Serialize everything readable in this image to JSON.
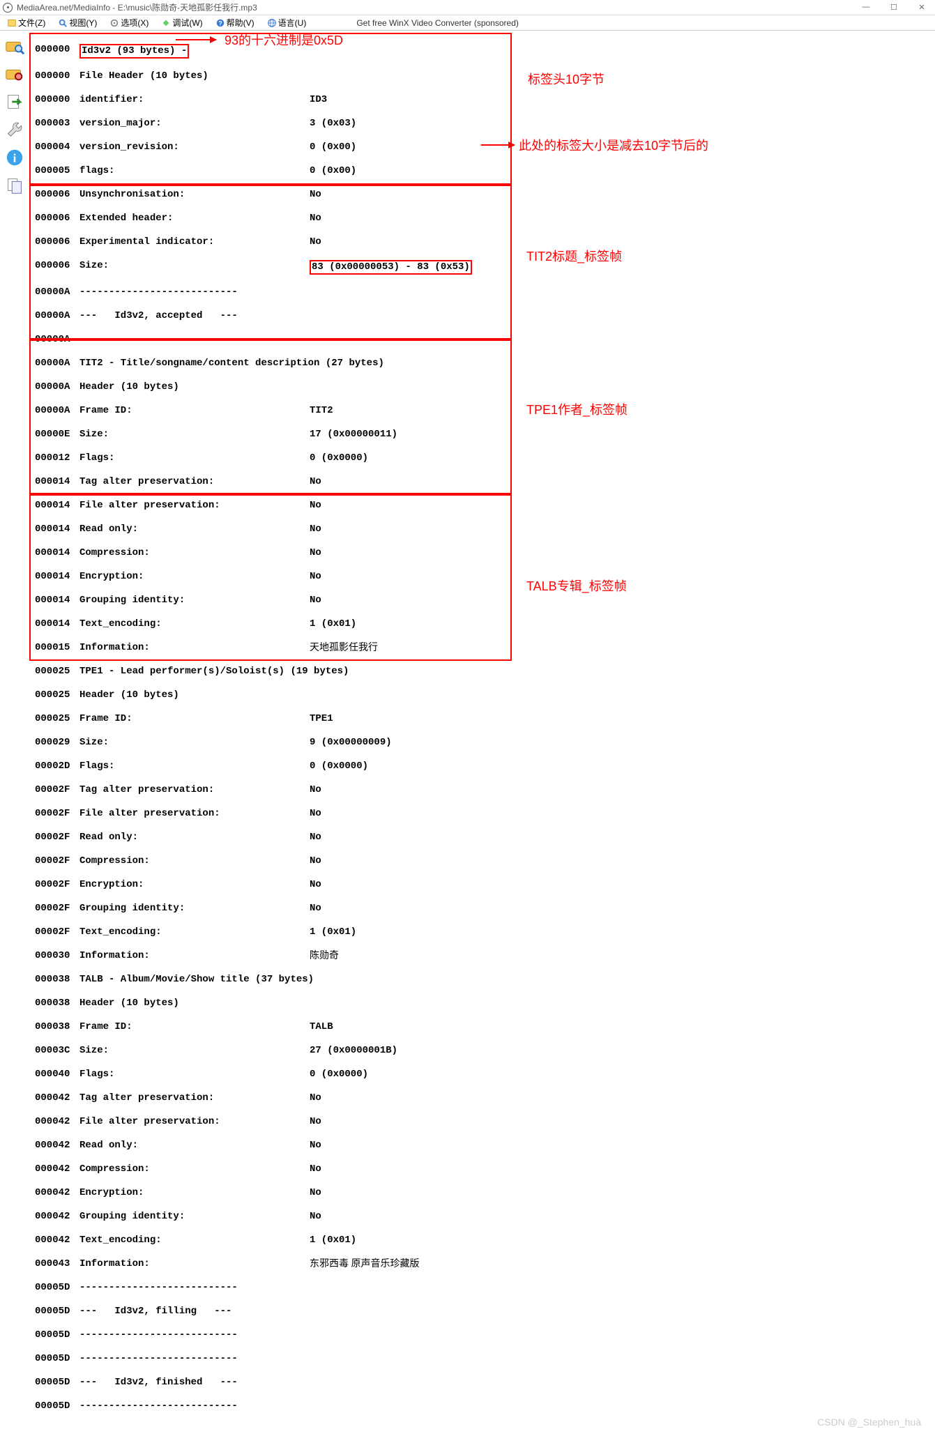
{
  "title": "MediaArea.net/MediaInfo - E:\\music\\陈勋奇-天地孤影任我行.mp3",
  "menus": {
    "file": "文件(Z)",
    "view": "视图(Y)",
    "options": "选项(X)",
    "debug": "调试(W)",
    "help": "帮助(V)",
    "language": "语言(U)",
    "sponsored": "Get free WinX Video Converter (sponsored)"
  },
  "sidebar_icons": [
    "folder-open",
    "folder-gear",
    "export",
    "wrench",
    "info",
    "clipboard"
  ],
  "annotations": {
    "a0": "93的十六进制是0x5D",
    "a1": "标签头10字节",
    "a2": "此处的标签大小是减去10字节后的",
    "a3": "TIT2标题_标签帧",
    "a4": "TPE1作者_标签帧",
    "a5": "TALB专辑_标签帧"
  },
  "hdr": {
    "id3v2_line": "Id3v2 (93 bytes) -",
    "file_header": "File Header (10 bytes)",
    "identifier_l": "identifier:",
    "identifier_v": "ID3",
    "vmaj_l": "version_major:",
    "vmaj_v": "3 (0x03)",
    "vrev_l": "version_revision:",
    "vrev_v": "0 (0x00)",
    "flags_l": "flags:",
    "flags_v": "0 (0x00)",
    "unsync_l": "Unsynchronisation:",
    "unsync_v": "No",
    "exthdr_l": "Extended header:",
    "exthdr_v": "No",
    "exp_l": "Experimental indicator:",
    "exp_v": "No",
    "size_l": "Size:",
    "size_v": "83 (0x00000053) - 83 (0x53)",
    "sep": "---------------------------",
    "accepted": "---   Id3v2, accepted   ---"
  },
  "tit2": {
    "head": "TIT2 - Title/songname/content description (27 bytes)",
    "hdr10": "Header (10 bytes)",
    "fid_l": "Frame ID:",
    "fid_v": "TIT2",
    "size_l": "Size:",
    "size_v": "17 (0x00000011)",
    "flags_l": "Flags:",
    "flags_v": "0 (0x0000)",
    "tap_l": "Tag alter preservation:",
    "tap_v": "No",
    "fap_l": "File alter preservation:",
    "fap_v": "No",
    "ro_l": "Read only:",
    "ro_v": "No",
    "comp_l": "Compression:",
    "comp_v": "No",
    "enc_l": "Encryption:",
    "enc_v": "No",
    "grp_l": "Grouping identity:",
    "grp_v": "No",
    "te_l": "Text_encoding:",
    "te_v": "1 (0x01)",
    "info_l": "Information:",
    "info_v": "天地孤影任我行"
  },
  "tpe1": {
    "head": "TPE1 - Lead performer(s)/Soloist(s) (19 bytes)",
    "hdr10": "Header (10 bytes)",
    "fid_l": "Frame ID:",
    "fid_v": "TPE1",
    "size_l": "Size:",
    "size_v": "9 (0x00000009)",
    "flags_l": "Flags:",
    "flags_v": "0 (0x0000)",
    "tap_l": "Tag alter preservation:",
    "tap_v": "No",
    "fap_l": "File alter preservation:",
    "fap_v": "No",
    "ro_l": "Read only:",
    "ro_v": "No",
    "comp_l": "Compression:",
    "comp_v": "No",
    "enc_l": "Encryption:",
    "enc_v": "No",
    "grp_l": "Grouping identity:",
    "grp_v": "No",
    "te_l": "Text_encoding:",
    "te_v": "1 (0x01)",
    "info_l": "Information:",
    "info_v": "陈勋奇"
  },
  "talb": {
    "head": "TALB - Album/Movie/Show title (37 bytes)",
    "hdr10": "Header (10 bytes)",
    "fid_l": "Frame ID:",
    "fid_v": "TALB",
    "size_l": "Size:",
    "size_v": "27 (0x0000001B)",
    "flags_l": "Flags:",
    "flags_v": "0 (0x0000)",
    "tap_l": "Tag alter preservation:",
    "tap_v": "No",
    "fap_l": "File alter preservation:",
    "fap_v": "No",
    "ro_l": "Read only:",
    "ro_v": "No",
    "comp_l": "Compression:",
    "comp_v": "No",
    "enc_l": "Encryption:",
    "enc_v": "No",
    "grp_l": "Grouping identity:",
    "grp_v": "No",
    "te_l": "Text_encoding:",
    "te_v": "1 (0x01)",
    "info_l": "Information:",
    "info_v": "东邪西毒 原声音乐珍藏版"
  },
  "footer": {
    "sep": "---------------------------",
    "filling": "---   Id3v2, filling   ---",
    "finished": "---   Id3v2, finished   ---"
  },
  "offsets": {
    "o000000": "000000",
    "o000003": "000003",
    "o000004": "000004",
    "o000005": "000005",
    "o000006": "000006",
    "o00000A": "00000A",
    "o00000E": "00000E",
    "o000012": "000012",
    "o000014": "000014",
    "o000015": "000015",
    "o000025": "000025",
    "o000029": "000029",
    "o00002D": "00002D",
    "o00002F": "00002F",
    "o000030": "000030",
    "o000038": "000038",
    "o00003C": "00003C",
    "o000040": "000040",
    "o000042": "000042",
    "o000043": "000043",
    "o00005D": "00005D"
  },
  "watermark": "CSDN @_Stephen_huà"
}
